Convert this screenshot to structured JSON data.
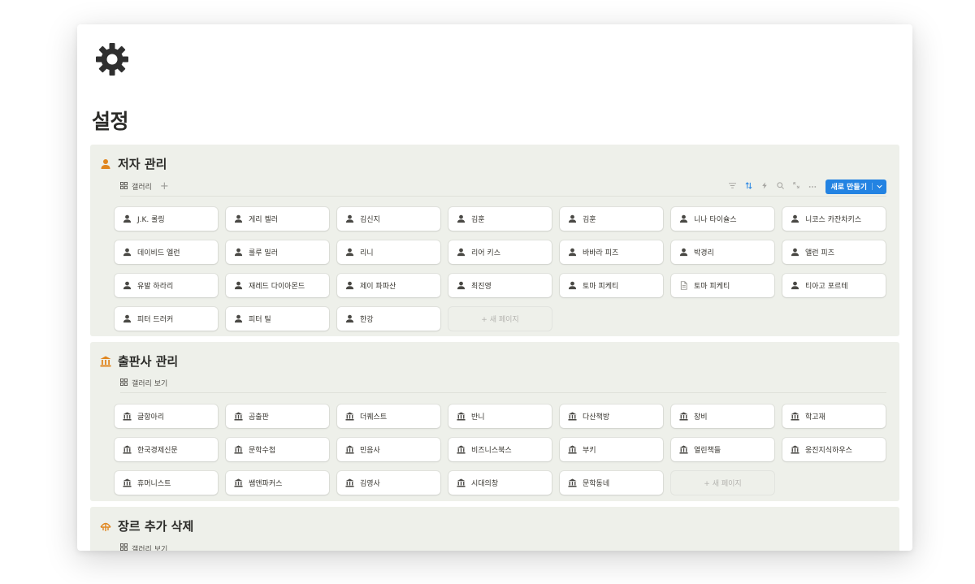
{
  "page": {
    "title": "설정",
    "icon": "gear-icon"
  },
  "authors": {
    "title": "저자 관리",
    "view_label": "갤러리",
    "add_view": "+",
    "new_button": "새로 만들기",
    "new_page": "+ 새 페이지",
    "items": [
      {
        "name": "J.K. 롤링",
        "icon": "person"
      },
      {
        "name": "게리 켈러",
        "icon": "person"
      },
      {
        "name": "김신지",
        "icon": "person"
      },
      {
        "name": "김훈",
        "icon": "person"
      },
      {
        "name": "김훈",
        "icon": "person"
      },
      {
        "name": "니나 타이슐스",
        "icon": "person"
      },
      {
        "name": "니코스 카잔차키스",
        "icon": "person"
      },
      {
        "name": "데이비드 엘런",
        "icon": "person"
      },
      {
        "name": "룰루 밀러",
        "icon": "person"
      },
      {
        "name": "리니",
        "icon": "person"
      },
      {
        "name": "리어 키스",
        "icon": "person"
      },
      {
        "name": "바바라 피즈",
        "icon": "person"
      },
      {
        "name": "박경리",
        "icon": "person"
      },
      {
        "name": "앨런 피즈",
        "icon": "person"
      },
      {
        "name": "유발 하라리",
        "icon": "person"
      },
      {
        "name": "재레드 다이아몬드",
        "icon": "person"
      },
      {
        "name": "제이 파파산",
        "icon": "person"
      },
      {
        "name": "최진영",
        "icon": "person"
      },
      {
        "name": "토마 피케티",
        "icon": "person"
      },
      {
        "name": "토마 피케티",
        "icon": "document"
      },
      {
        "name": "티아고 포르테",
        "icon": "person"
      },
      {
        "name": "피터 드러커",
        "icon": "person"
      },
      {
        "name": "피터 틸",
        "icon": "person"
      },
      {
        "name": "한강",
        "icon": "person"
      }
    ]
  },
  "publishers": {
    "title": "출판사 관리",
    "view_label": "갤러리 보기",
    "new_page": "+ 새 페이지",
    "items": [
      "글항아리",
      "곰출판",
      "더퀘스트",
      "반니",
      "다산책방",
      "창비",
      "학고재",
      "한국경제신문",
      "문학수첩",
      "민음사",
      "비즈니스북스",
      "부키",
      "열린책들",
      "웅진지식하우스",
      "휴머니스트",
      "쌤앤파커스",
      "김영사",
      "시대의창",
      "문학동네"
    ]
  },
  "genres": {
    "title": "장르 추가 삭제",
    "view_label": "갤러리 보기"
  },
  "colors": {
    "accent": "#2383e2",
    "section_bg": "#eef0ea",
    "icon_orange": "#e0861f"
  }
}
